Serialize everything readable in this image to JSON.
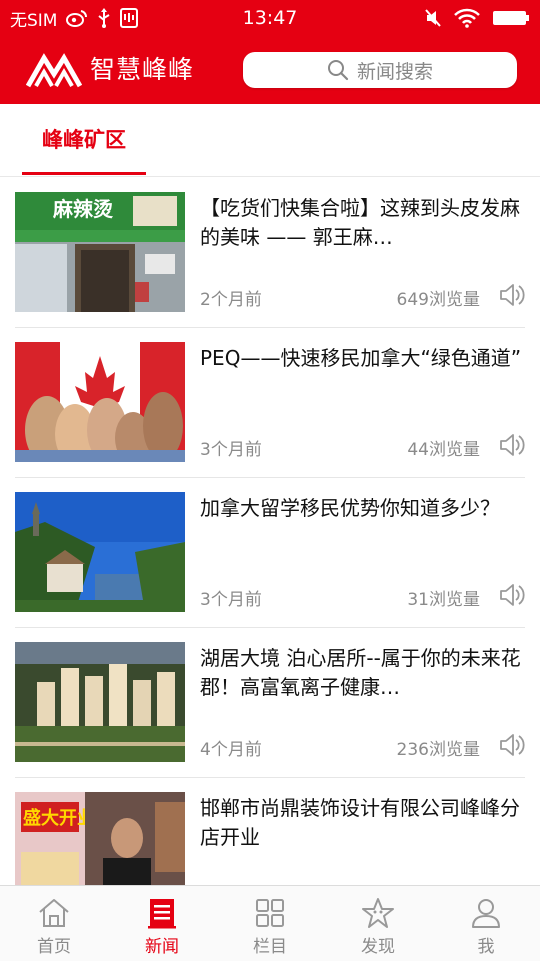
{
  "status_bar": {
    "carrier": "无SIM",
    "time": "13:47"
  },
  "header": {
    "brand": "智慧峰峰",
    "search_placeholder": "新闻搜索"
  },
  "tabs": [
    {
      "label": "峰峰矿区",
      "active": true
    }
  ],
  "news": [
    {
      "title": "【吃货们快集合啦】这辣到头皮发麻的美味 —— 郭王麻…",
      "time": "2个月前",
      "views": "649浏览量",
      "thumb_sign": "麻辣烫"
    },
    {
      "title": "PEQ——快速移民加拿大“绿色通道”",
      "time": "3个月前",
      "views": "44浏览量"
    },
    {
      "title": "加拿大留学移民优势你知道多少？",
      "time": "3个月前",
      "views": "31浏览量"
    },
    {
      "title": "湖居大境  泊心居所--属于你的未来花郡！高富氧离子健康…",
      "time": "4个月前",
      "views": "236浏览量"
    },
    {
      "title": "邯郸市尚鼎装饰设计有限公司峰峰分店开业",
      "time": "",
      "views": "",
      "thumb_sign": "盛大开业"
    }
  ],
  "bottom_nav": [
    {
      "label": "首页",
      "icon": "home-icon",
      "active": false
    },
    {
      "label": "新闻",
      "icon": "news-icon",
      "active": true
    },
    {
      "label": "栏目",
      "icon": "grid-icon",
      "active": false
    },
    {
      "label": "发现",
      "icon": "star-icon",
      "active": false
    },
    {
      "label": "我",
      "icon": "user-icon",
      "active": false
    }
  ],
  "colors": {
    "brand_red": "#e50012",
    "text_gray": "#8a8a8a"
  }
}
